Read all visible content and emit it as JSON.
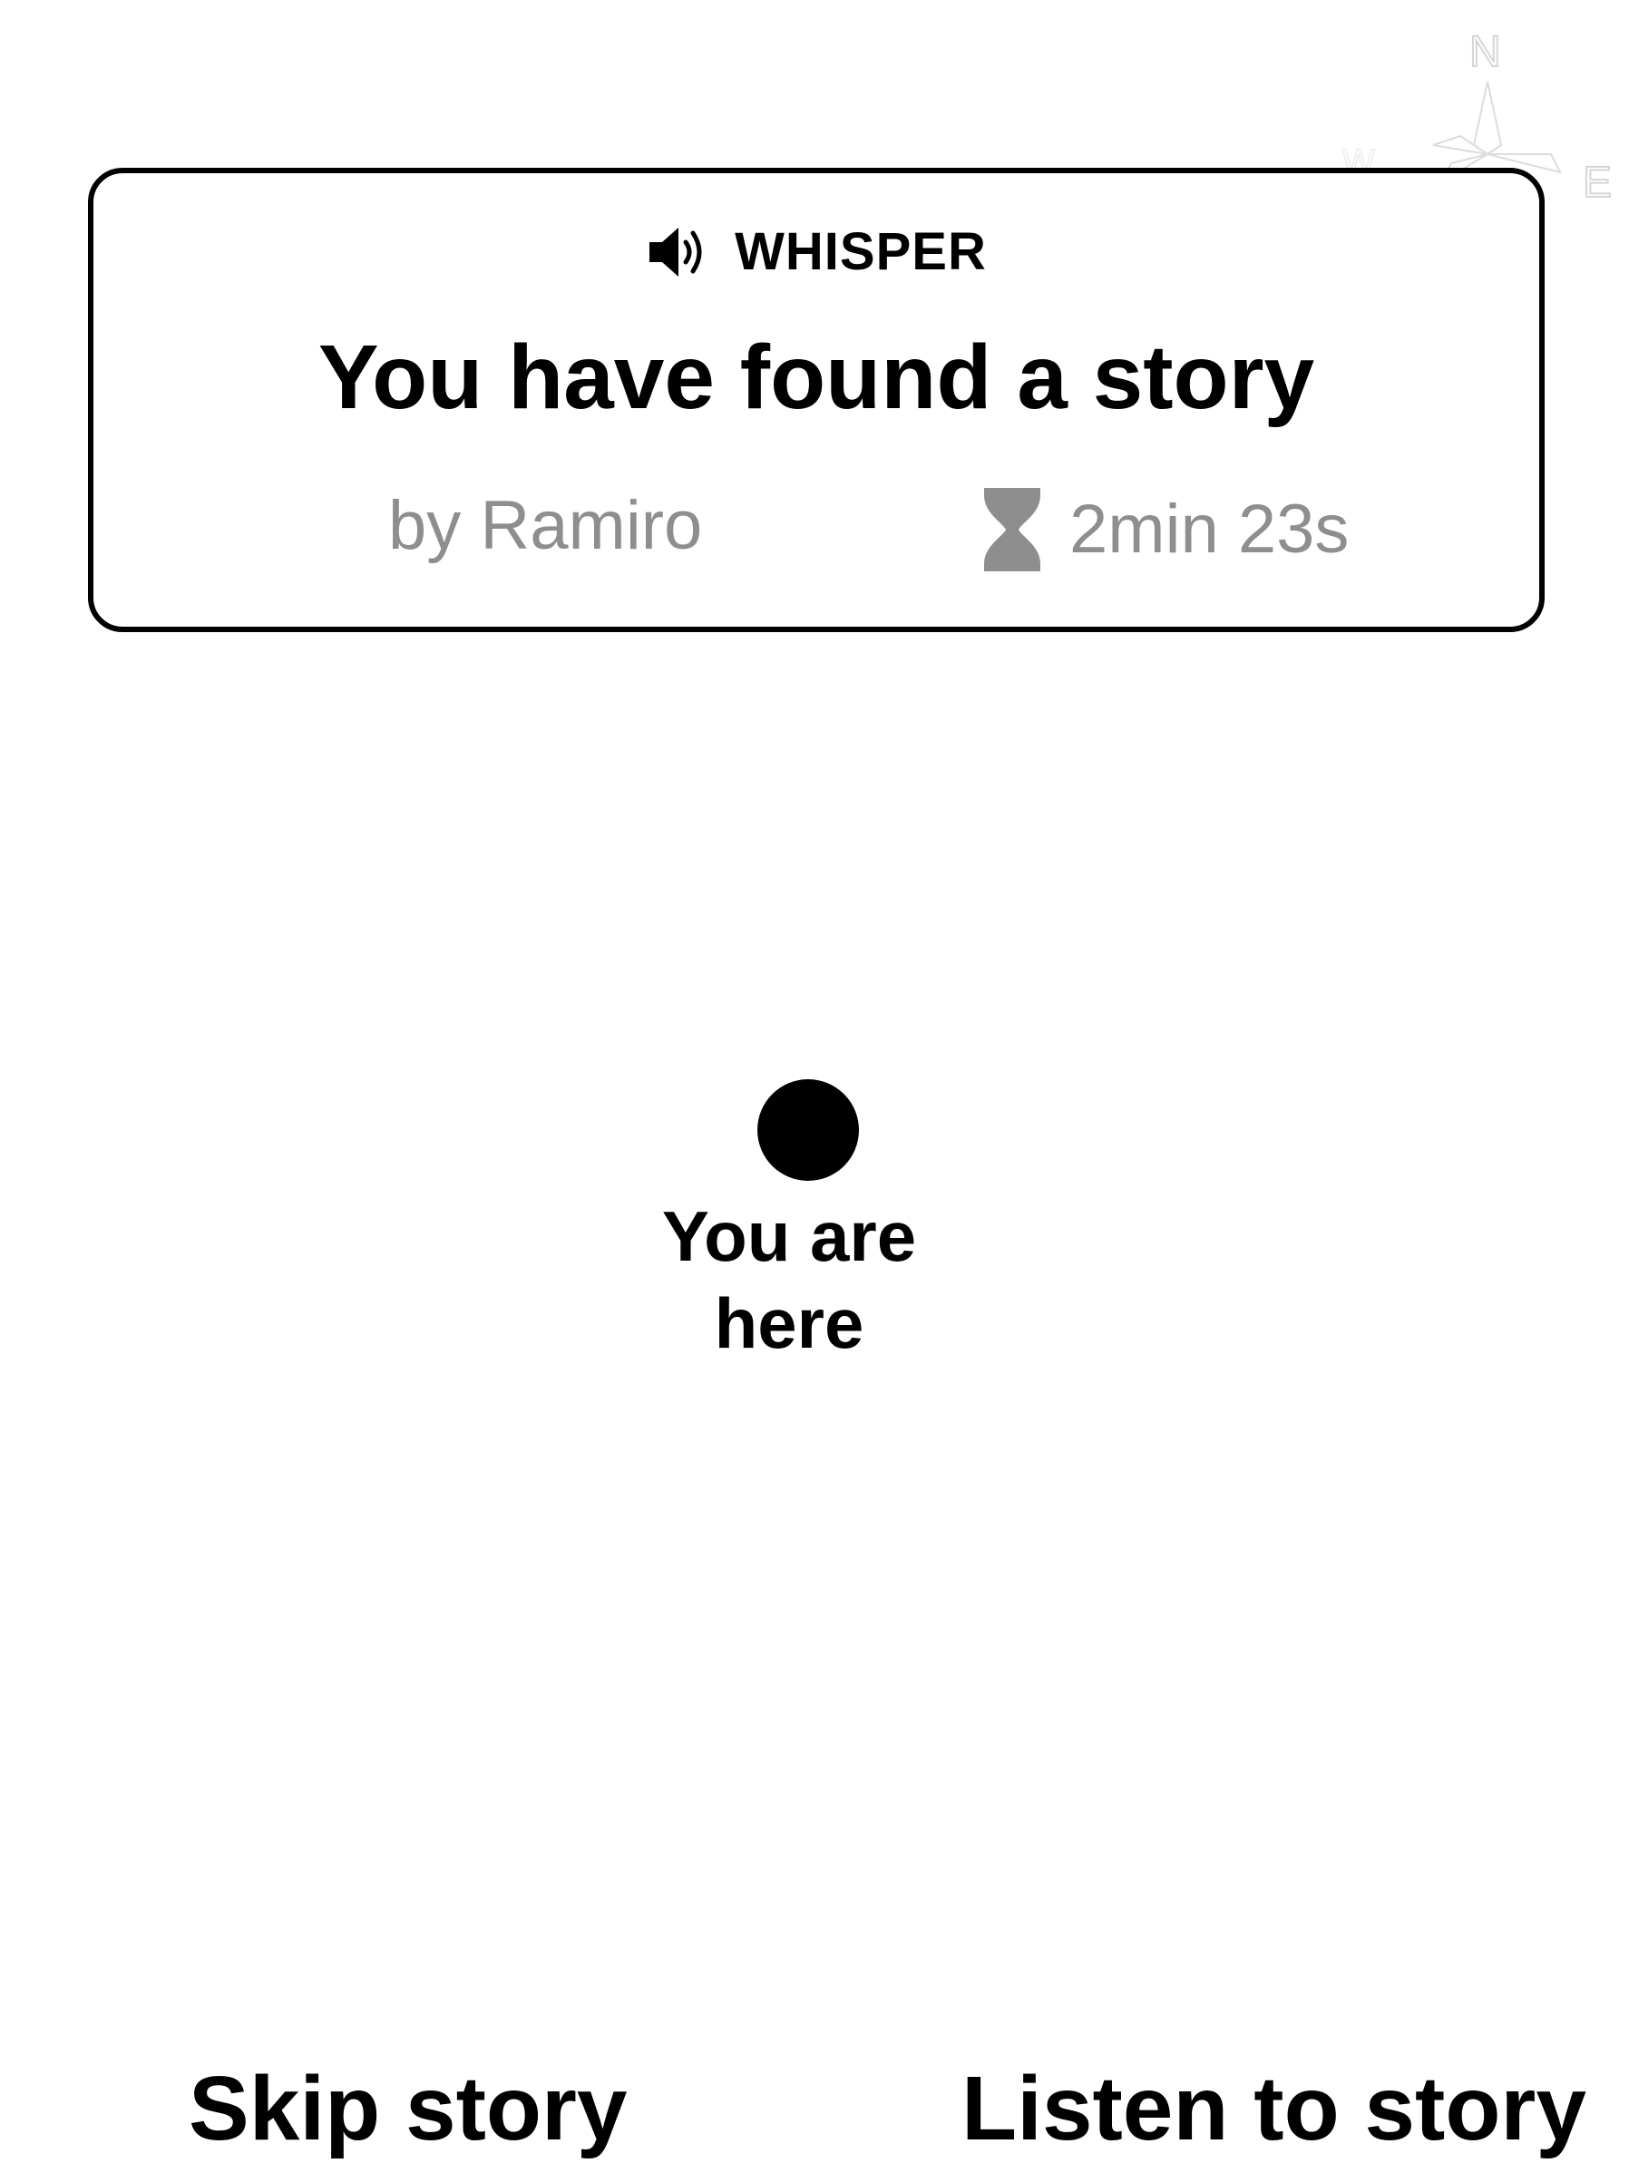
{
  "compass": {
    "north": "N",
    "west": "W",
    "east": "E",
    "icon": "compass-icon"
  },
  "story_card": {
    "type_icon": "speaker-icon",
    "type_label": "WHISPER",
    "title": "You have found a story",
    "author": "by Ramiro",
    "duration_icon": "hourglass-icon",
    "duration": "2min 23s"
  },
  "location": {
    "label": "You are\nhere"
  },
  "actions": {
    "skip_label": "Skip story",
    "listen_label": "Listen to story"
  },
  "colors": {
    "text": "#000000",
    "muted": "#8e8e8e",
    "background": "#ffffff"
  }
}
